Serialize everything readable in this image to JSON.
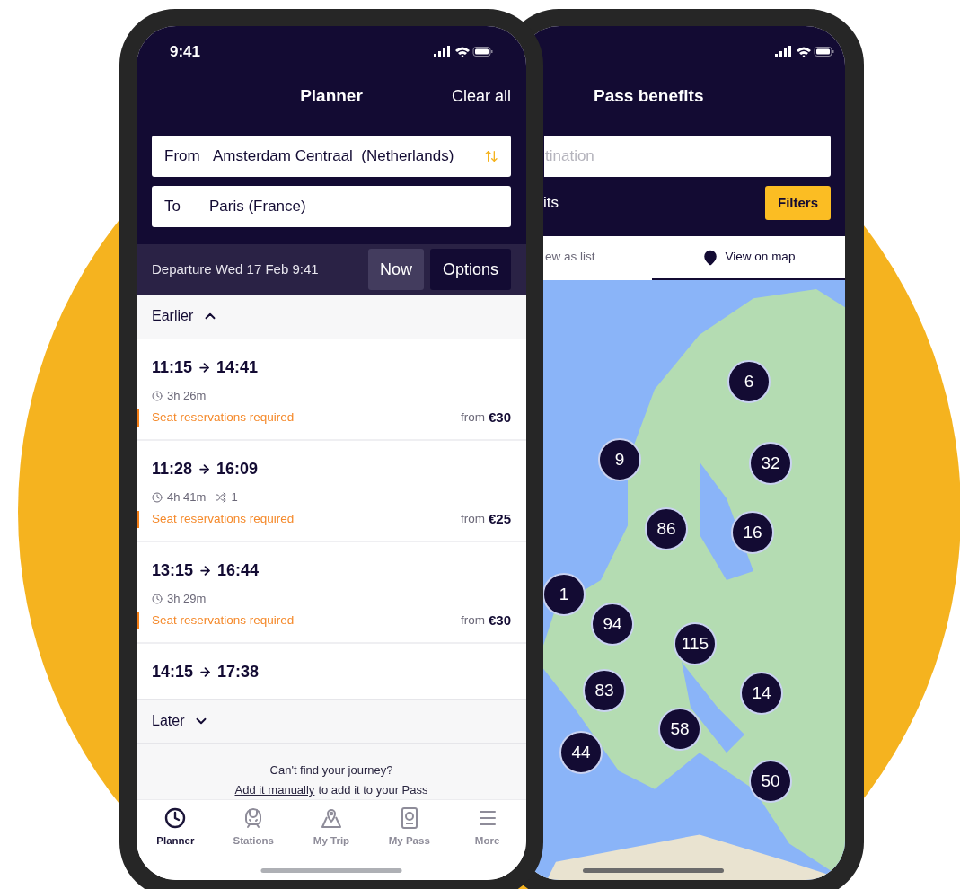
{
  "left_phone": {
    "status_bar": {
      "time": "9:41"
    },
    "header": {
      "title": "Planner",
      "action": "Clear all"
    },
    "from": {
      "label": "From",
      "value": "Amsterdam Centraal  (Netherlands)"
    },
    "to": {
      "label": "To",
      "value": "Paris (France)"
    },
    "departure": {
      "label": "Departure",
      "value": "Wed 17 Feb 9:41"
    },
    "buttons": [
      {
        "label": "Now",
        "kind": "secondary"
      },
      {
        "label": "Options",
        "kind": "primary"
      }
    ],
    "earlier": {
      "label": "Earlier",
      "expanded": true
    },
    "journeys": [
      {
        "departure": "11:15",
        "arrival": "14:41",
        "duration": "3h 26m",
        "note": "Seat reservations required",
        "price_prefix": "from",
        "price": "€30"
      },
      {
        "departure": "11:28",
        "arrival": "16:09",
        "duration": "4h 41m",
        "changes": "1",
        "note": "Seat reservations required",
        "price_prefix": "from",
        "price": "€25"
      },
      {
        "departure": "13:15",
        "arrival": "16:44",
        "duration": "3h 29m",
        "note": "Seat reservations required",
        "price_prefix": "from",
        "price": "€30"
      },
      {
        "departure": "14:15",
        "arrival": "17:38"
      }
    ],
    "later": {
      "label": "Later",
      "expanded": false
    },
    "footer": {
      "question": "Can't find your journey?",
      "link": "Add it manually",
      "rest": "to add it to your Pass"
    },
    "tab_bar": [
      {
        "label": "Planner",
        "selected": true
      },
      {
        "label": "Stations",
        "selected": false
      },
      {
        "label": "My Trip",
        "selected": false
      },
      {
        "label": "My Pass",
        "selected": false
      },
      {
        "label": "More",
        "selected": false
      }
    ]
  },
  "right_phone": {
    "title": "Pass benefits",
    "search": {
      "placeholder": "tination"
    },
    "results_label": "its",
    "filter_button": "Filters",
    "tabs": [
      {
        "label": "ew as list",
        "selected": false
      },
      {
        "label": "View on map",
        "selected": true
      }
    ],
    "map": {
      "clusters": [
        {
          "label": "6"
        },
        {
          "label": "9"
        },
        {
          "label": "32"
        },
        {
          "label": "86"
        },
        {
          "label": "16"
        },
        {
          "label": "1"
        },
        {
          "label": "94"
        },
        {
          "label": "115"
        },
        {
          "label": "83"
        },
        {
          "label": "14"
        },
        {
          "label": "58"
        },
        {
          "label": "44"
        },
        {
          "label": "50"
        }
      ]
    }
  }
}
